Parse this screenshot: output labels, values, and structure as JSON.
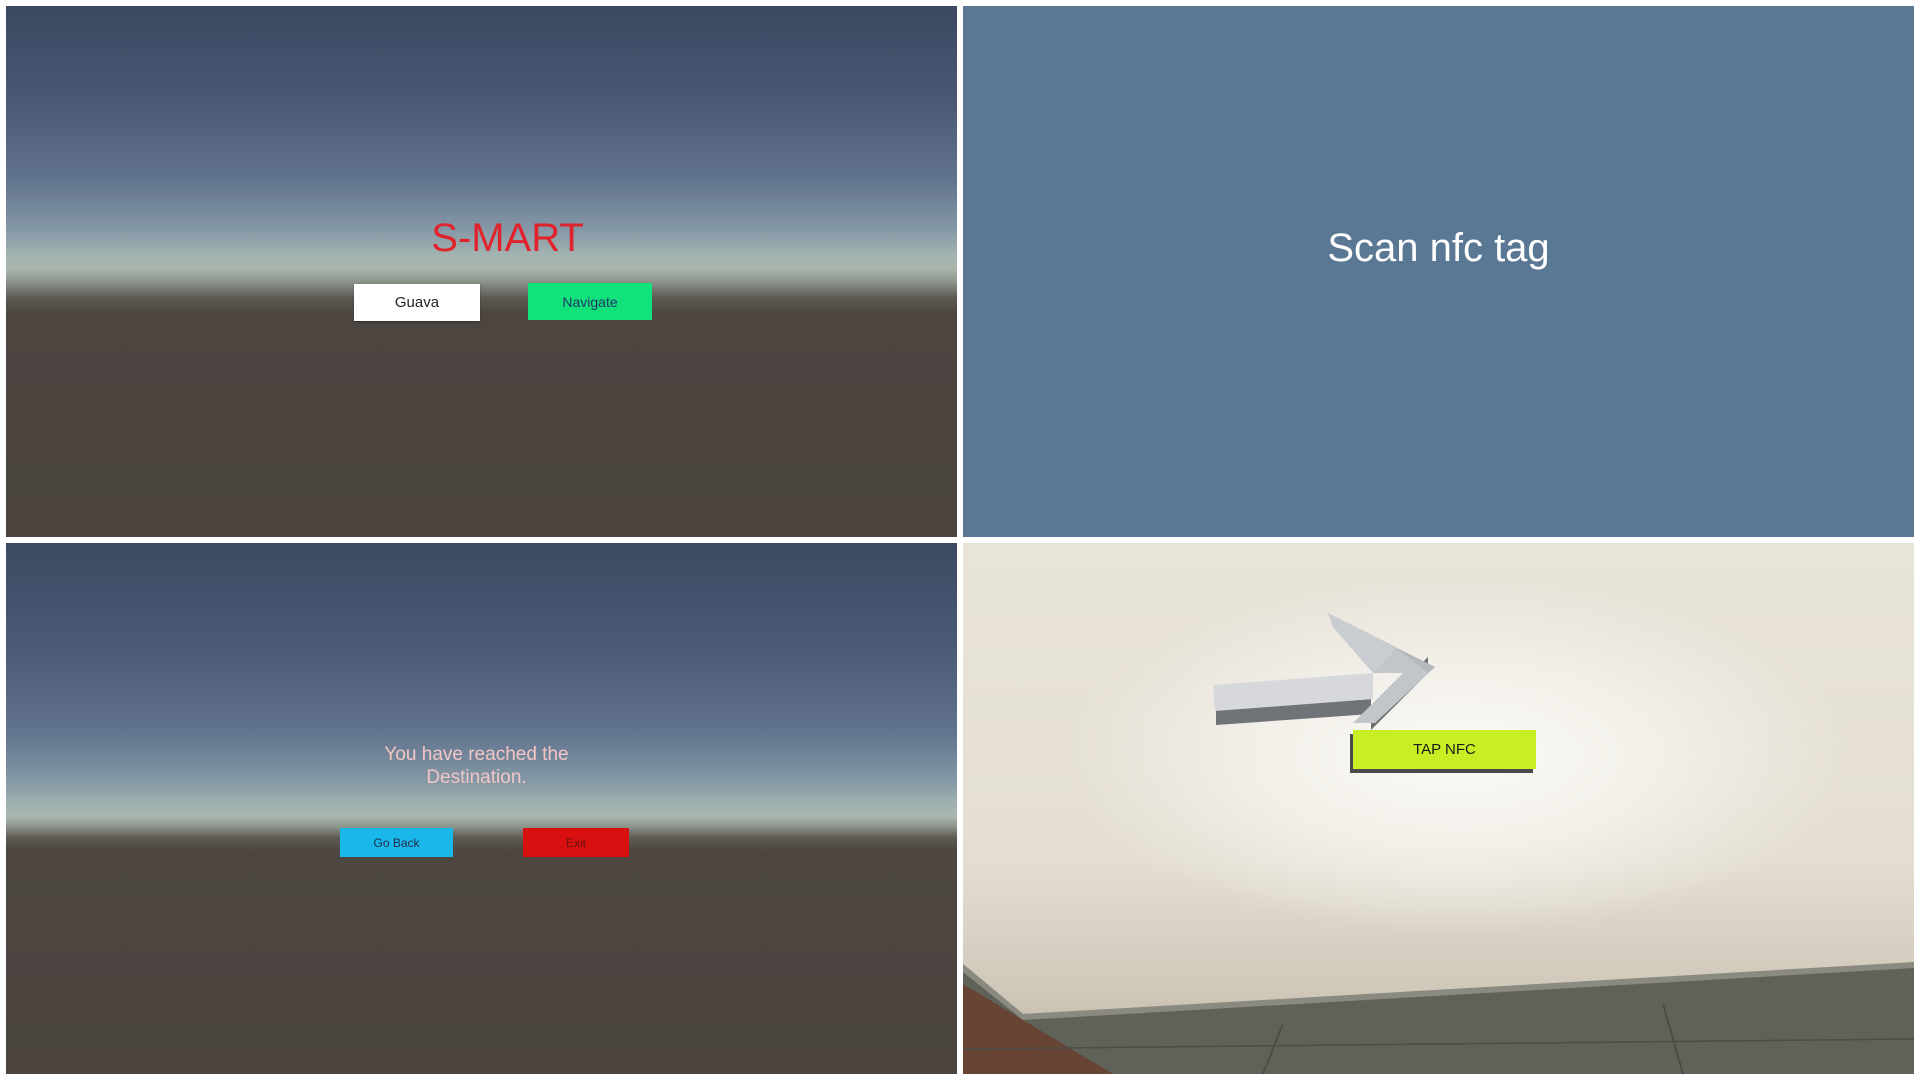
{
  "screen_menu": {
    "title": "S-MART",
    "item_button_label": "Guava",
    "navigate_button_label": "Navigate"
  },
  "screen_scan": {
    "prompt": "Scan nfc tag"
  },
  "screen_destination": {
    "message_line1": "You have reached the",
    "message_line2": "Destination.",
    "go_back_label": "Go Back",
    "exit_label": "Exit"
  },
  "screen_ar": {
    "tap_button_label": "TAP NFC",
    "arrow_icon": "arrow-right-3d-icon"
  },
  "colors": {
    "title_red": "#e0232c",
    "navigate_green": "#12e27a",
    "scan_background": "#5a7894",
    "go_back_blue": "#19b7ea",
    "exit_red": "#d81010",
    "tap_nfc_lime": "#c8ef23"
  }
}
